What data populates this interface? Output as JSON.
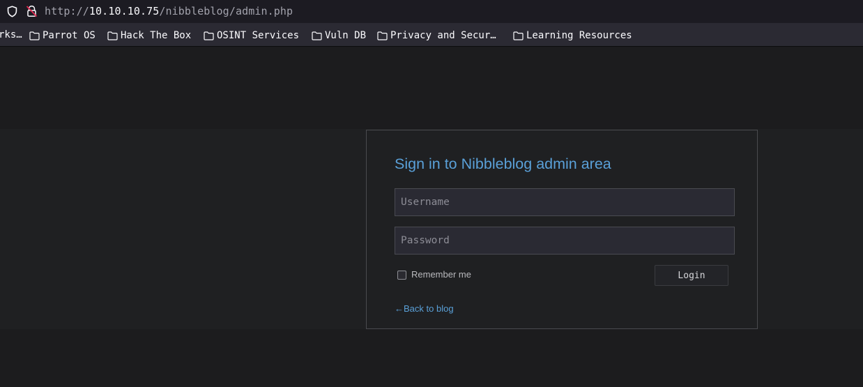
{
  "browser": {
    "url_scheme": "http://",
    "url_host": "10.10.10.75",
    "url_path": "/nibbleblog/admin.php",
    "icons": [
      "shield-icon",
      "lock-icon"
    ]
  },
  "bookmarks": {
    "overflow_label": "rks…",
    "items": [
      {
        "label": "Parrot OS",
        "icon": "folder-icon"
      },
      {
        "label": "Hack The Box",
        "icon": "folder-icon"
      },
      {
        "label": "OSINT Services",
        "icon": "folder-icon"
      },
      {
        "label": "Vuln DB",
        "icon": "folder-icon"
      },
      {
        "label": "Privacy and Secur…",
        "icon": "folder-icon"
      },
      {
        "label": "Learning Resources",
        "icon": "folder-icon"
      }
    ]
  },
  "login": {
    "title": "Sign in to Nibbleblog admin area",
    "username_placeholder": "Username",
    "username_value": "",
    "password_placeholder": "Password",
    "password_value": "",
    "remember_label": "Remember me",
    "remember_checked": false,
    "login_button": "Login",
    "back_link": "←Back to blog"
  },
  "colors": {
    "accent_link": "#5aa0d8",
    "page_background": "#1c1c1e",
    "panel_background": "#1f2022",
    "toolbar_background": "#2b2a33"
  }
}
